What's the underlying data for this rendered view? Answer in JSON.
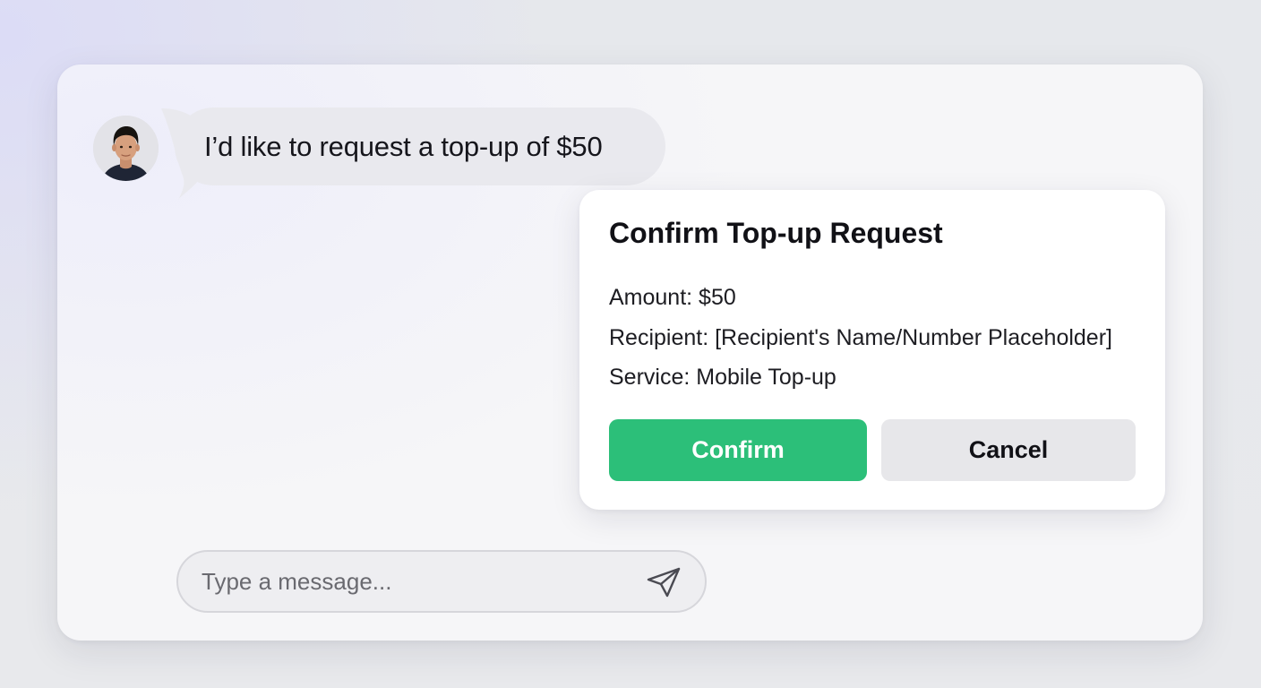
{
  "chat": {
    "user_message": "I’d like to request a top-up of $50"
  },
  "confirm_card": {
    "title": "Confirm Top-up Request",
    "amount_line": "Amount: $50",
    "recipient_line": "Recipient: [Recipient's Name/Number Placeholder]",
    "service_line": "Service: Mobile Top-up",
    "confirm_label": "Confirm",
    "cancel_label": "Cancel"
  },
  "composer": {
    "placeholder": "Type a message..."
  },
  "icons": {
    "avatar": "user-avatar",
    "send": "send-icon"
  },
  "colors": {
    "confirm_button": "#2cbf79",
    "cancel_button": "#e7e7ea",
    "bubble": "#e9e9ee"
  }
}
